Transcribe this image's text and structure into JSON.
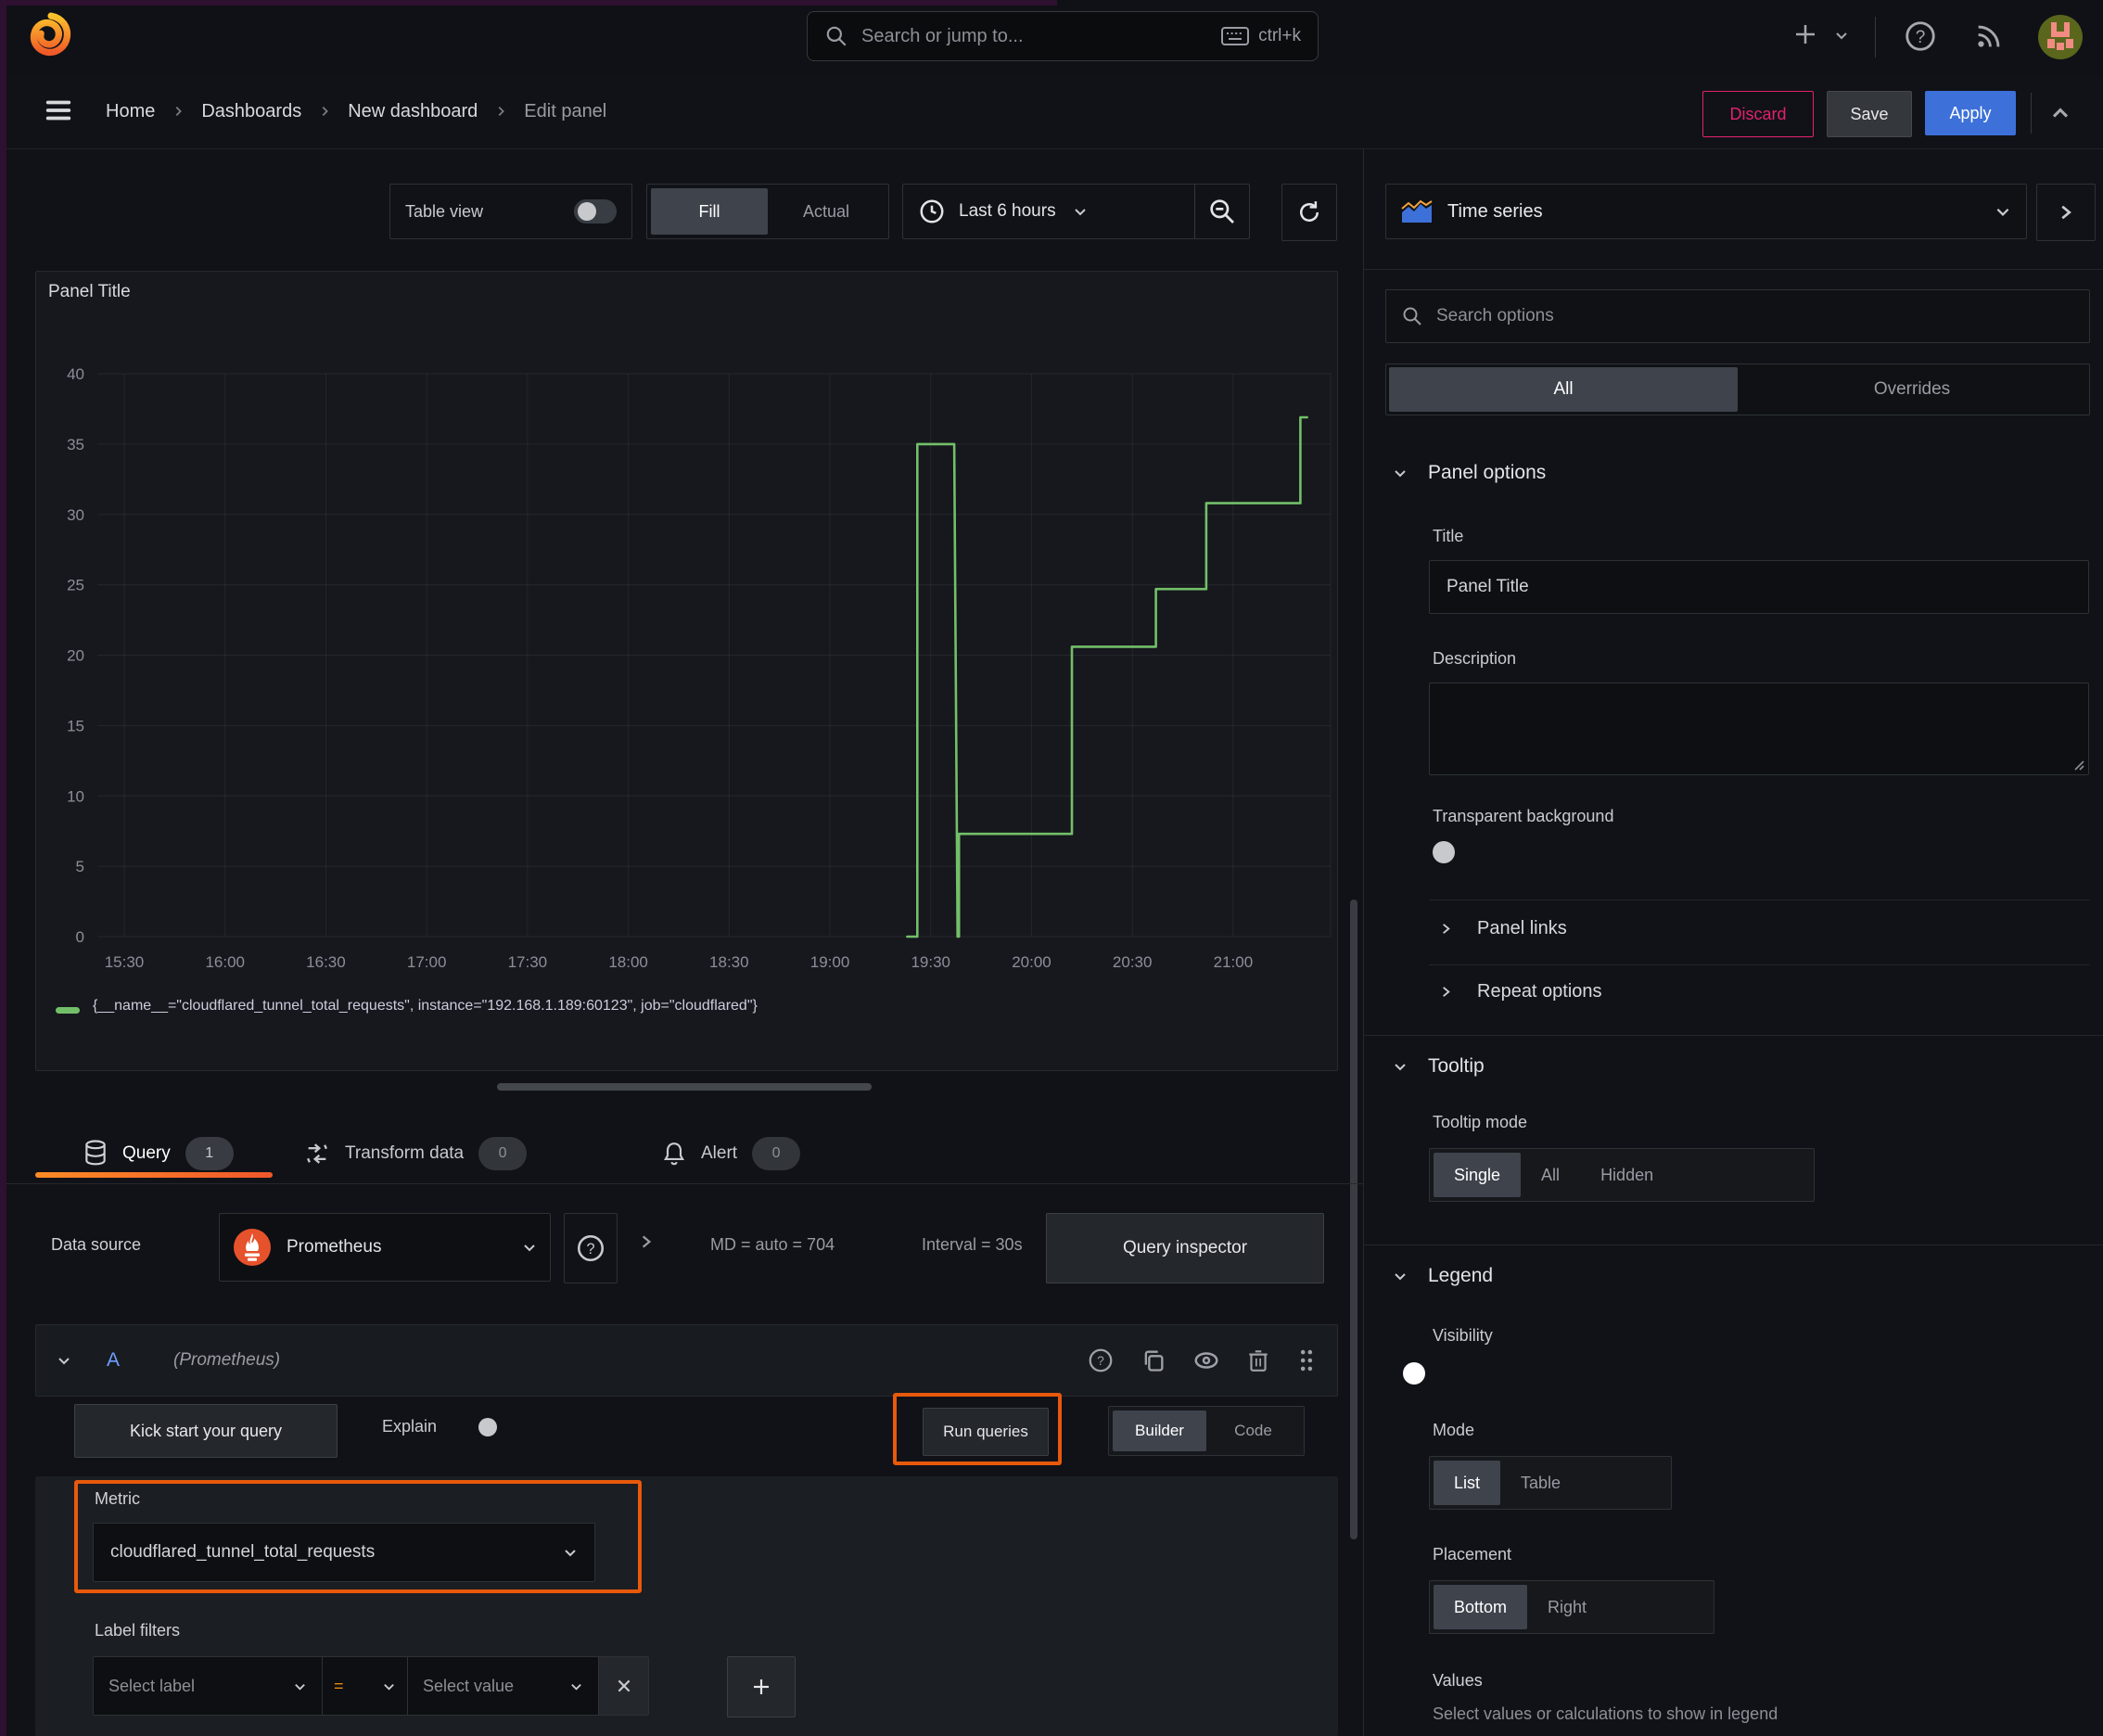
{
  "topbar": {
    "search_placeholder": "Search or jump to...",
    "search_shortcut": "ctrl+k"
  },
  "breadcrumb": {
    "items": [
      "Home",
      "Dashboards",
      "New dashboard",
      "Edit panel"
    ]
  },
  "header_actions": {
    "discard": "Discard",
    "save": "Save",
    "apply": "Apply"
  },
  "toolbar": {
    "table_view_label": "Table view",
    "fill_label": "Fill",
    "actual_label": "Actual",
    "time_range_label": "Last 6 hours"
  },
  "viz_picker": {
    "label": "Time series"
  },
  "options_panel": {
    "search_placeholder": "Search options",
    "tab_all": "All",
    "tab_overrides": "Overrides",
    "panel_options_title": "Panel options",
    "title_label": "Title",
    "title_value": "Panel Title",
    "description_label": "Description",
    "transparent_label": "Transparent background",
    "panel_links_label": "Panel links",
    "repeat_options_label": "Repeat options",
    "tooltip_title": "Tooltip",
    "tooltip_mode_label": "Tooltip mode",
    "tooltip_single": "Single",
    "tooltip_all": "All",
    "tooltip_hidden": "Hidden",
    "legend_title": "Legend",
    "visibility_label": "Visibility",
    "mode_label": "Mode",
    "mode_list": "List",
    "mode_table": "Table",
    "placement_label": "Placement",
    "placement_bottom": "Bottom",
    "placement_right": "Right",
    "values_label": "Values",
    "values_help": "Select values or calculations to show in legend"
  },
  "query_tabs": {
    "query_label": "Query",
    "query_count": "1",
    "transform_label": "Transform data",
    "transform_count": "0",
    "alert_label": "Alert",
    "alert_count": "0"
  },
  "datasource_row": {
    "label": "Data source",
    "name": "Prometheus",
    "stats_md": "MD = auto = 704",
    "stats_interval": "Interval = 30s",
    "inspector_label": "Query inspector"
  },
  "query_row": {
    "ref_id": "A",
    "ds_hint": "(Prometheus)"
  },
  "query_editor": {
    "kickstart_label": "Kick start your query",
    "explain_label": "Explain",
    "run_label": "Run queries",
    "builder_label": "Builder",
    "code_label": "Code",
    "metric_label": "Metric",
    "metric_value": "cloudflared_tunnel_total_requests",
    "label_filters_label": "Label filters",
    "select_label_placeholder": "Select label",
    "operator": "=",
    "select_value_placeholder": "Select value"
  },
  "chart_data": {
    "type": "line",
    "title": "Panel Title",
    "xlabel": "",
    "ylabel": "",
    "grid": true,
    "legend_position": "bottom",
    "x_tick_labels": [
      "15:30",
      "16:00",
      "16:30",
      "17:00",
      "17:30",
      "18:00",
      "18:30",
      "19:00",
      "19:30",
      "20:00",
      "20:30",
      "21:00"
    ],
    "x_tick_minutes": [
      930,
      960,
      990,
      1020,
      1050,
      1080,
      1110,
      1140,
      1170,
      1200,
      1230,
      1260
    ],
    "x_range_minutes": [
      922,
      1289
    ],
    "y_ticks": [
      0,
      5,
      10,
      15,
      20,
      25,
      30,
      35,
      40
    ],
    "ylim": [
      0,
      40
    ],
    "series": [
      {
        "name": "{__name__=\"cloudflared_tunnel_total_requests\", instance=\"192.168.1.189:60123\", job=\"cloudflared\"}",
        "color": "#73bf69",
        "points": [
          [
            1163,
            0
          ],
          [
            1166,
            0
          ],
          [
            1166,
            35
          ],
          [
            1177,
            35
          ],
          [
            1178,
            0
          ],
          [
            1178.4,
            0
          ],
          [
            1178.4,
            7.3
          ],
          [
            1212,
            7.3
          ],
          [
            1212,
            20.6
          ],
          [
            1237,
            20.6
          ],
          [
            1237,
            24.7
          ],
          [
            1252,
            24.7
          ],
          [
            1252,
            30.8
          ],
          [
            1280,
            30.8
          ],
          [
            1280,
            36.9
          ],
          [
            1282,
            36.9
          ]
        ]
      }
    ]
  },
  "colors": {
    "accent_orange": "#e8590c",
    "tab_underline_from": "#fb8b25",
    "tab_underline_to": "#f0572b",
    "accent_blue": "#3d71d9",
    "series_green": "#73bf69",
    "discard_pink": "#e0226e",
    "prometheus_orange": "#e6522c"
  }
}
